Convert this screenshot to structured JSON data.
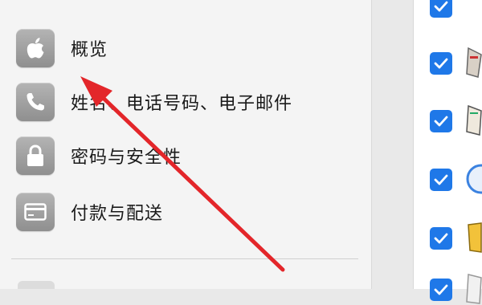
{
  "sidebar": {
    "items": [
      {
        "label": "概览",
        "icon": "apple-icon"
      },
      {
        "label": "姓名、电话号码、电子邮件",
        "icon": "phone-icon"
      },
      {
        "label": "密码与安全性",
        "icon": "lock-icon"
      },
      {
        "label": "付款与配送",
        "icon": "credit-card-icon"
      }
    ]
  },
  "right_column": {
    "checkbox_states": [
      true,
      true,
      true,
      true,
      true,
      true
    ]
  },
  "colors": {
    "checkbox_accent": "#1f78e8",
    "annotation_arrow": "#e3262a",
    "icon_tile": "#9d9d9d"
  }
}
